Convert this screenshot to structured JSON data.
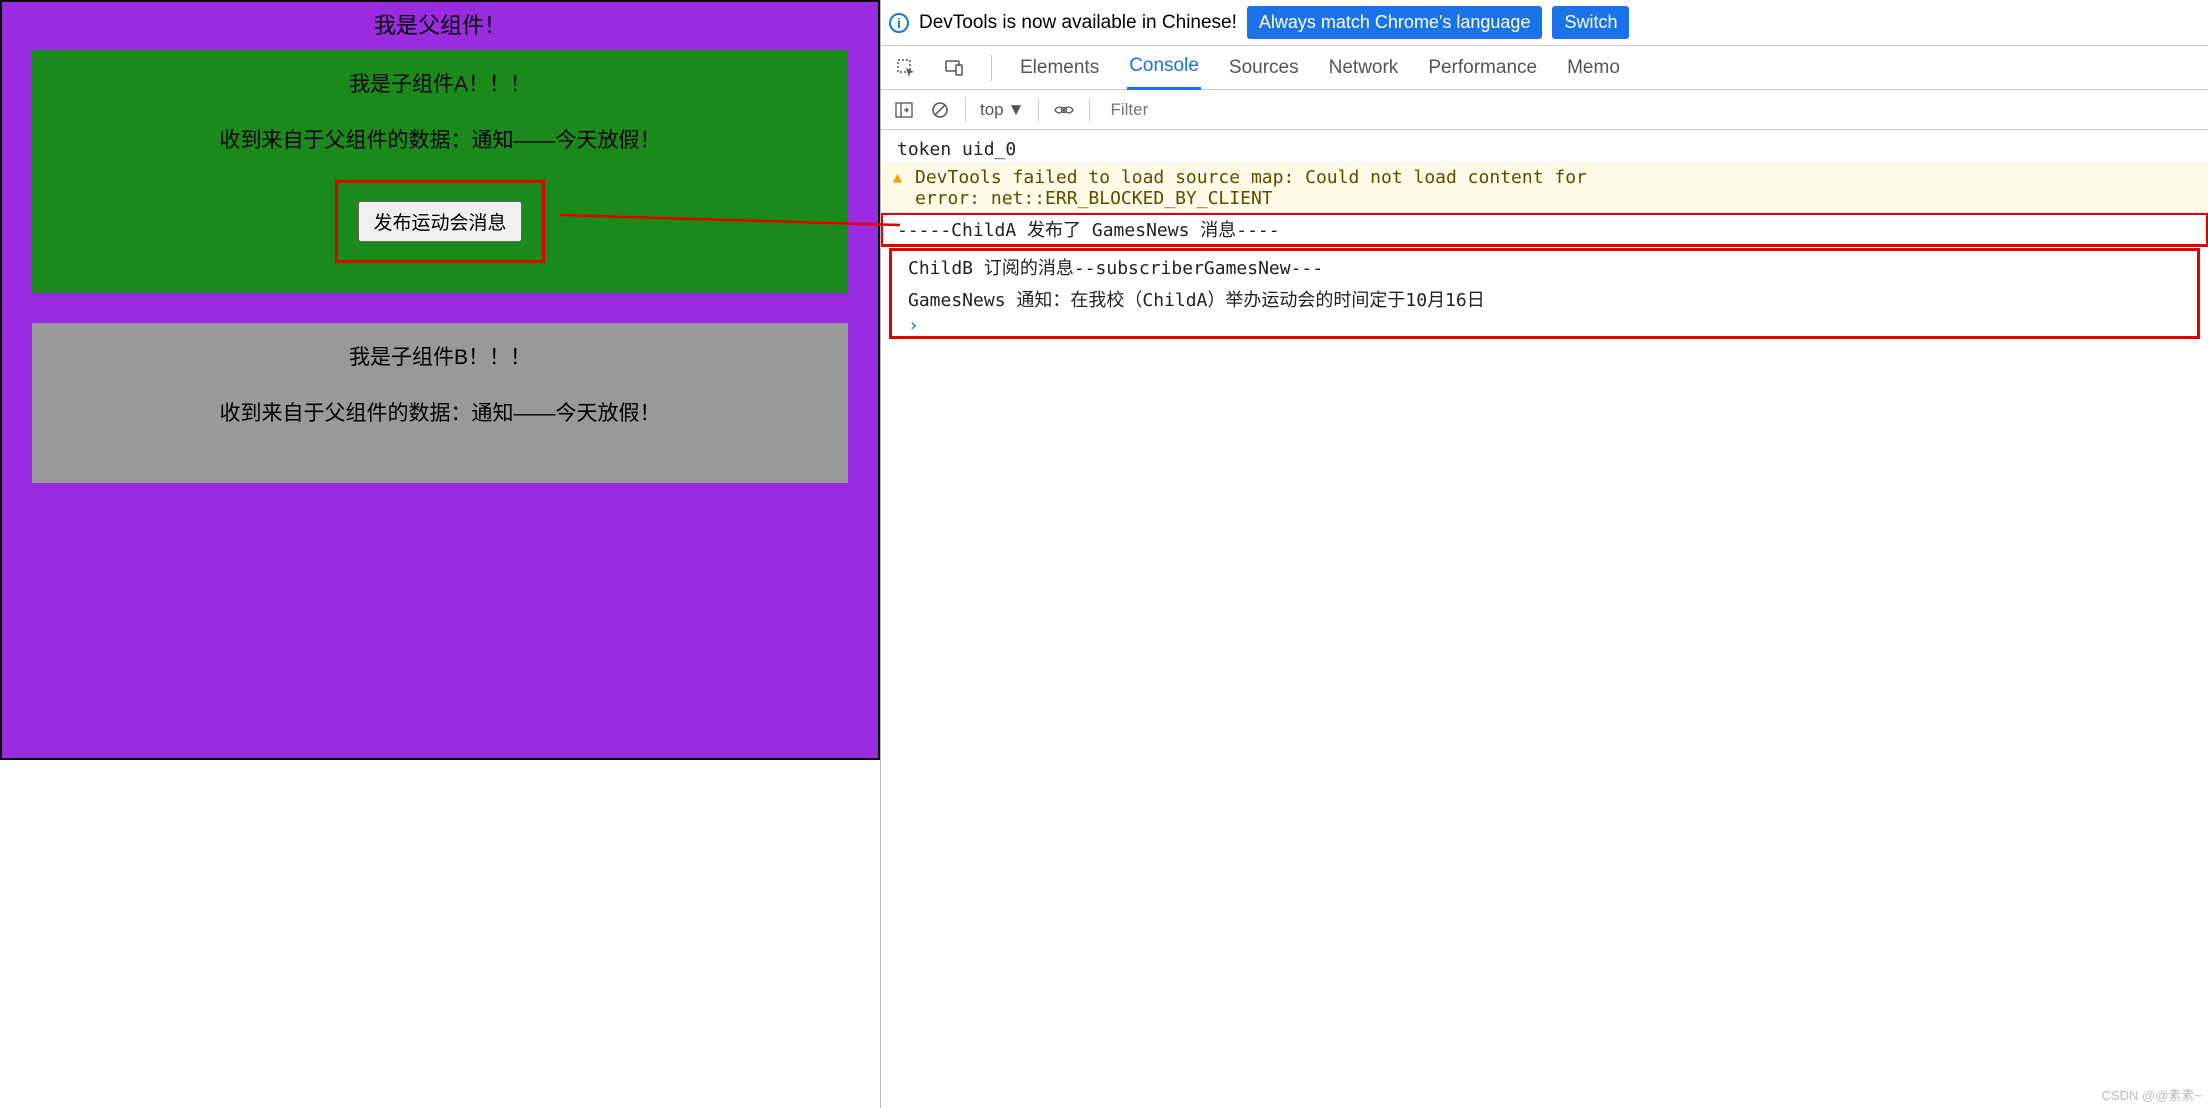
{
  "app": {
    "parent_title": "我是父组件！",
    "child_a": {
      "title": "我是子组件A！！！",
      "received": "收到来自于父组件的数据：通知——今天放假！",
      "button_label": "发布运动会消息"
    },
    "child_b": {
      "title": "我是子组件B！！！",
      "received": "收到来自于父组件的数据：通知——今天放假！"
    }
  },
  "devtools": {
    "banner": {
      "text": "DevTools is now available in Chinese!",
      "match_btn": "Always match Chrome's language",
      "switch_btn": "Switch"
    },
    "tabs": {
      "elements": "Elements",
      "console": "Console",
      "sources": "Sources",
      "network": "Network",
      "performance": "Performance",
      "memory": "Memo"
    },
    "filterbar": {
      "context": "top",
      "filter_placeholder": "Filter"
    },
    "logs": {
      "l1": "token uid_0",
      "l2a": "DevTools failed to load source map: Could not load content for ",
      "l2b": "error: net::ERR_BLOCKED_BY_CLIENT",
      "l3": "-----ChildA 发布了 GamesNews 消息----",
      "l4": "ChildB 订阅的消息--subscriberGamesNew---",
      "l5": "GamesNews 通知：在我校（ChildA）举办运动会的时间定于10月16日"
    }
  },
  "watermark": "CSDN @@素素~"
}
